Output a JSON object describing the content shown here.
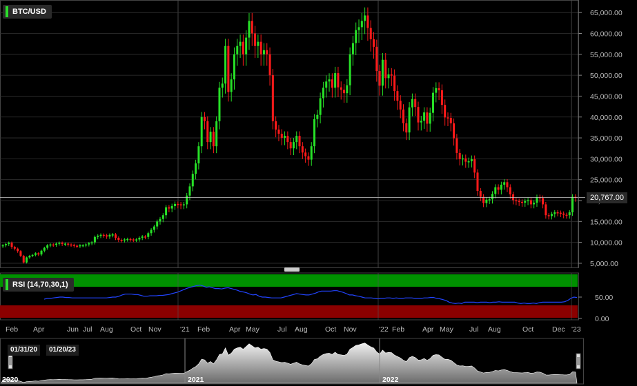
{
  "symbol": "BTC/USD",
  "last_price": "20,767.00",
  "rsi": {
    "label": "RSI (14,70,30,1)",
    "ticks": [
      "50.00",
      "0.00"
    ],
    "values": [
      45,
      47,
      47,
      48,
      49,
      50,
      50,
      49,
      49,
      48,
      48,
      48,
      48,
      48,
      48,
      48,
      48,
      48,
      48,
      48,
      48,
      49,
      50,
      50,
      52,
      55,
      57,
      57,
      57,
      56,
      56,
      54,
      52,
      52,
      53,
      53,
      53,
      54,
      54,
      55,
      56,
      58,
      60,
      62,
      65,
      68,
      71,
      73,
      75,
      77,
      78,
      76,
      73,
      74,
      72,
      70,
      70,
      69,
      71,
      72,
      70,
      68,
      66,
      63,
      62,
      60,
      57,
      55,
      56,
      52,
      50,
      50,
      49,
      48,
      48,
      48,
      48,
      50,
      52,
      54,
      56,
      58,
      57,
      56,
      55,
      55,
      57,
      59,
      62,
      64,
      64,
      64,
      64,
      65,
      65,
      63,
      61,
      58,
      55,
      55,
      53,
      52,
      50,
      48,
      48,
      48,
      47,
      46,
      47,
      47,
      48,
      48,
      47,
      48,
      47,
      47,
      48,
      48,
      48,
      47,
      47,
      47,
      48,
      48,
      49,
      49,
      47,
      46,
      44,
      42,
      38,
      36,
      35,
      36,
      35,
      38,
      38,
      38,
      38,
      37,
      38,
      38,
      38,
      37,
      38,
      38,
      39,
      38,
      38,
      38,
      38,
      38,
      36,
      35,
      36,
      35,
      35,
      36,
      35,
      37,
      38,
      38,
      38,
      38,
      38,
      38,
      38,
      39,
      42,
      47,
      50,
      49
    ]
  },
  "chart_data": {
    "type": "candlestick",
    "title": "BTC/USD",
    "ylim": [
      4000,
      68000
    ],
    "y_ticks": [
      "5,000.00",
      "10,000.00",
      "15,000.00",
      "20,000.00",
      "25,000.00",
      "30,000.00",
      "35,000.00",
      "40,000.00",
      "45,000.00",
      "50,000.00",
      "55,000.00",
      "60,000.00",
      "65,000.00"
    ],
    "x_ticks": [
      "Feb",
      "Apr",
      "Jun",
      "Jul",
      "Aug",
      "Oct",
      "Nov",
      "'21",
      "Feb",
      "Apr",
      "May",
      "Jul",
      "Aug",
      "Oct",
      "Nov",
      "'22",
      "Feb",
      "Apr",
      "May",
      "Jul",
      "Aug",
      "Oct",
      "Dec",
      "'23"
    ],
    "closes": [
      9300,
      9600,
      9900,
      8900,
      8500,
      7900,
      6800,
      5200,
      6400,
      6800,
      7000,
      7400,
      7100,
      8000,
      8700,
      9300,
      9500,
      9400,
      9700,
      9900,
      9600,
      9700,
      9500,
      9400,
      9200,
      9100,
      9300,
      9300,
      9500,
      9800,
      10000,
      11300,
      11600,
      11800,
      11700,
      11400,
      11800,
      11900,
      11100,
      10600,
      10500,
      10700,
      10800,
      10700,
      10600,
      10700,
      11100,
      11400,
      11300,
      12200,
      13000,
      13800,
      15000,
      15600,
      16500,
      18400,
      18100,
      18700,
      19200,
      19100,
      18900,
      19100,
      21200,
      23400,
      26400,
      28900,
      33000,
      40000,
      39000,
      34000,
      36500,
      33000,
      39000,
      47000,
      48000,
      57000,
      46000,
      49000,
      55000,
      57000,
      58000,
      55000,
      59000,
      63000,
      60000,
      57000,
      58000,
      55000,
      56000,
      55000,
      50000,
      39000,
      37000,
      36000,
      35000,
      35500,
      34000,
      32500,
      34000,
      35500,
      33000,
      31500,
      30600,
      29800,
      33000,
      39500,
      40500,
      44500,
      47000,
      48500,
      49000,
      47000,
      50500,
      47100,
      46500,
      45700,
      47600,
      55000,
      57700,
      60800,
      61500,
      63000,
      64300,
      61300,
      58600,
      56800,
      51000,
      47500,
      53700,
      49300,
      50200,
      49900,
      46200,
      43900,
      41800,
      38500,
      36300,
      42300,
      44300,
      42400,
      38700,
      39100,
      41100,
      38400,
      41000,
      45800,
      46900,
      46400,
      42900,
      39900,
      39800,
      38500,
      34900,
      31400,
      29900,
      30100,
      29300,
      29400,
      29900,
      26700,
      22300,
      20900,
      19400,
      20200,
      20300,
      21600,
      23200,
      22600,
      23800,
      24400,
      23200,
      21500,
      20100,
      19900,
      19700,
      19500,
      19900,
      20100,
      19100,
      19500,
      20800,
      20600,
      19100,
      16500,
      16300,
      16800,
      17200,
      17100,
      16900,
      16600,
      16500,
      17200,
      20900,
      20767
    ]
  }
}
